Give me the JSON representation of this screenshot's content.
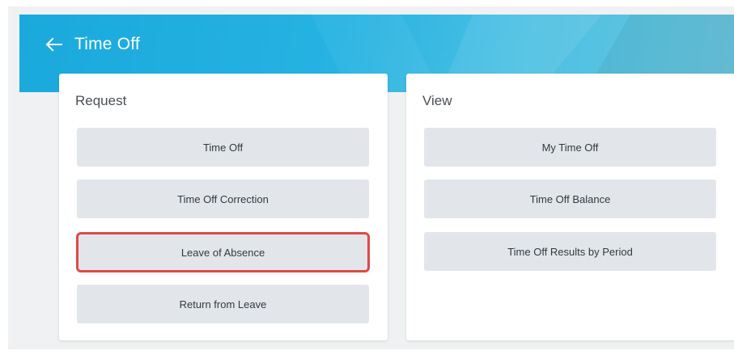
{
  "header": {
    "title": "Time Off"
  },
  "request_card": {
    "title": "Request",
    "buttons": [
      "Time Off",
      "Time Off Correction",
      "Leave of Absence",
      "Return from Leave"
    ]
  },
  "view_card": {
    "title": "View",
    "buttons": [
      "My Time Off",
      "Time Off Balance",
      "Time Off Results by Period"
    ]
  },
  "colors": {
    "banner": "#1aa9dc",
    "highlight": "#e04848",
    "button_bg": "#e2e6ea"
  },
  "icons": {
    "back": "arrow-left-icon"
  }
}
